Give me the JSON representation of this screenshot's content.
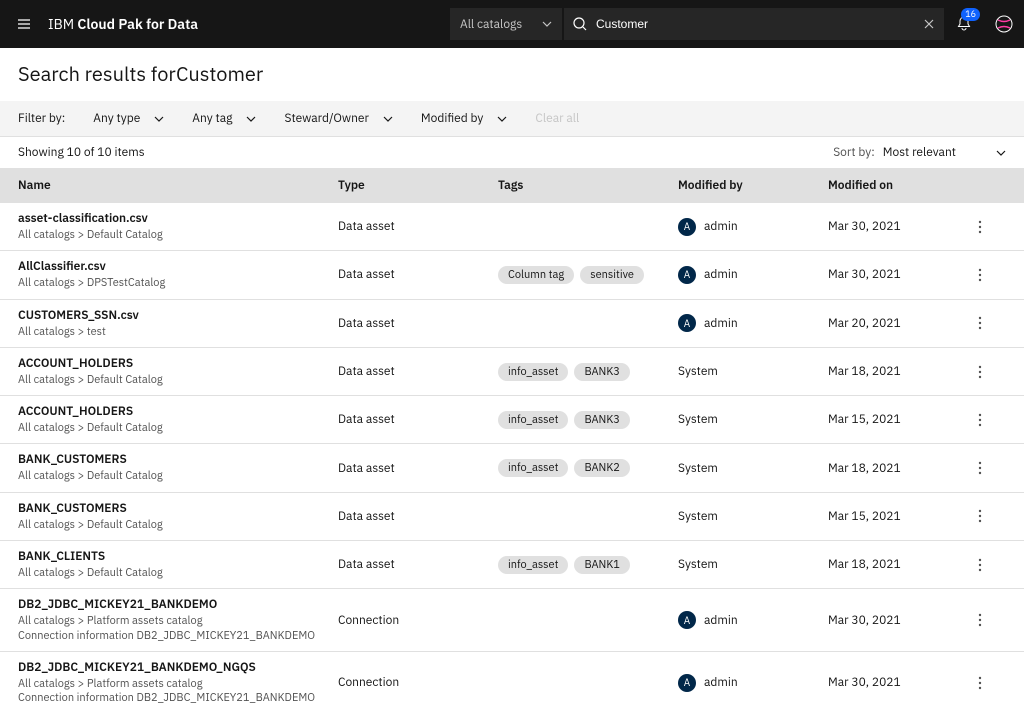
{
  "header": {
    "brand_prefix": "IBM ",
    "brand_main": "Cloud Pak for Data",
    "catalog_dropdown": "All catalogs",
    "search_value": "Customer",
    "notif_count": "16"
  },
  "title": {
    "prefix": "Search results for",
    "term": "Customer"
  },
  "filters": {
    "label": "Filter by:",
    "any_type": "Any type",
    "any_tag": "Any tag",
    "steward": "Steward/Owner",
    "modified_by": "Modified by",
    "clear_all": "Clear all"
  },
  "meta": {
    "showing": "Showing 10 of 10 items",
    "sort_label": "Sort by:",
    "sort_value": "Most relevant"
  },
  "columns": {
    "name": "Name",
    "type": "Type",
    "tags": "Tags",
    "modified_by": "Modified by",
    "modified_on": "Modified on"
  },
  "rows": [
    {
      "name": "asset-classification.csv",
      "crumb": "All catalogs > Default Catalog",
      "desc": "",
      "type": "Data asset",
      "tags": [],
      "modby_avatar": "A",
      "modby": "admin",
      "modon": "Mar 30, 2021"
    },
    {
      "name": "AllClassifier.csv",
      "crumb": "All catalogs > DPSTestCatalog",
      "desc": "",
      "type": "Data asset",
      "tags": [
        "Column tag",
        "sensitive"
      ],
      "modby_avatar": "A",
      "modby": "admin",
      "modon": "Mar 30, 2021"
    },
    {
      "name": "CUSTOMERS_SSN.csv",
      "crumb": "All catalogs > test",
      "desc": "",
      "type": "Data asset",
      "tags": [],
      "modby_avatar": "A",
      "modby": "admin",
      "modon": "Mar 20, 2021"
    },
    {
      "name": "ACCOUNT_HOLDERS",
      "crumb": "All catalogs > Default Catalog",
      "desc": "",
      "type": "Data asset",
      "tags": [
        "info_asset",
        "BANK3"
      ],
      "modby_avatar": "",
      "modby": "System",
      "modon": "Mar 18, 2021"
    },
    {
      "name": "ACCOUNT_HOLDERS",
      "crumb": "All catalogs > Default Catalog",
      "desc": "",
      "type": "Data asset",
      "tags": [
        "info_asset",
        "BANK3"
      ],
      "modby_avatar": "",
      "modby": "System",
      "modon": "Mar 15, 2021"
    },
    {
      "name": "BANK_CUSTOMERS",
      "crumb": "All catalogs > Default Catalog",
      "desc": "",
      "type": "Data asset",
      "tags": [
        "info_asset",
        "BANK2"
      ],
      "modby_avatar": "",
      "modby": "System",
      "modon": "Mar 18, 2021"
    },
    {
      "name": "BANK_CUSTOMERS",
      "crumb": "All catalogs > Default Catalog",
      "desc": "",
      "type": "Data asset",
      "tags": [],
      "modby_avatar": "",
      "modby": "System",
      "modon": "Mar 15, 2021"
    },
    {
      "name": "BANK_CLIENTS",
      "crumb": "All catalogs > Default Catalog",
      "desc": "",
      "type": "Data asset",
      "tags": [
        "info_asset",
        "BANK1"
      ],
      "modby_avatar": "",
      "modby": "System",
      "modon": "Mar 18, 2021"
    },
    {
      "name": "DB2_JDBC_MICKEY21_BANKDEMO",
      "crumb": "All catalogs > Platform assets catalog",
      "desc": "Connection information DB2_JDBC_MICKEY21_BANKDEMO",
      "type": "Connection",
      "tags": [],
      "modby_avatar": "A",
      "modby": "admin",
      "modon": "Mar 30, 2021"
    },
    {
      "name": "DB2_JDBC_MICKEY21_BANKDEMO_NGQS",
      "crumb": "All catalogs > Platform assets catalog",
      "desc": "Connection information DB2_JDBC_MICKEY21_BANKDEMO",
      "type": "Connection",
      "tags": [],
      "modby_avatar": "A",
      "modby": "admin",
      "modon": "Mar 30, 2021"
    }
  ]
}
